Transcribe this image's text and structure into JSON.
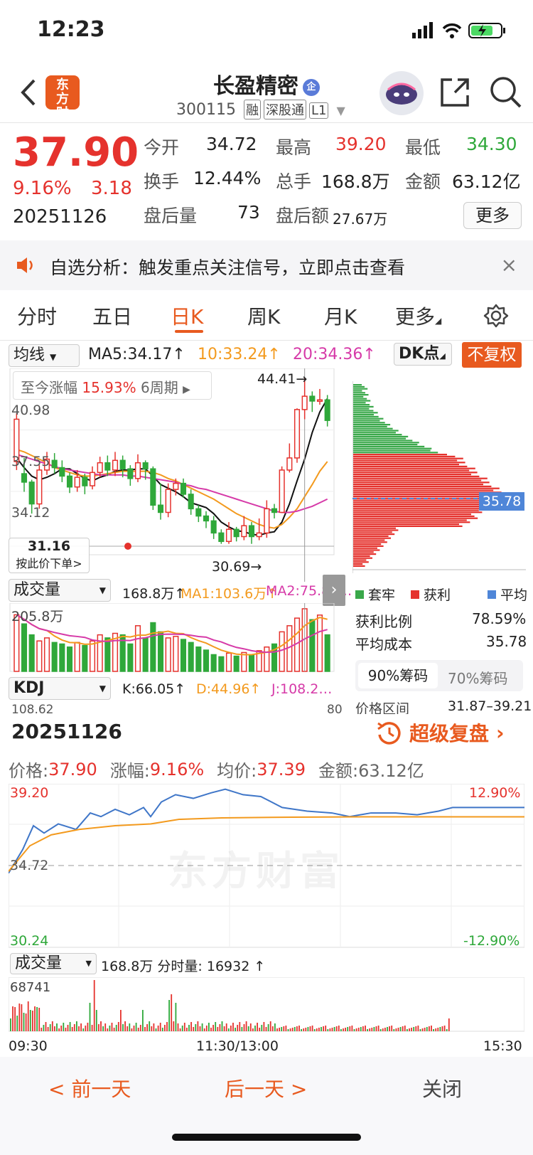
{
  "status": {
    "time": "12:23"
  },
  "header": {
    "logo_text": "东方财富",
    "name": "长盈精密",
    "name_badge": "企",
    "code": "300115",
    "tags": [
      "融",
      "深股通",
      "L1"
    ]
  },
  "quote": {
    "price": "37.90",
    "change_pct": "9.16%",
    "change_amt": "3.18",
    "date": "20251126",
    "open_label": "今开",
    "open": "34.72",
    "high_label": "最高",
    "high": "39.20",
    "low_label": "最低",
    "low": "34.30",
    "turnover_label": "换手",
    "turnover": "12.44%",
    "vol_label": "总手",
    "vol": "168.8万",
    "amount_label": "金额",
    "amount": "63.12亿",
    "after_vol_label": "盘后量",
    "after_vol": "73",
    "after_amt_label": "盘后额",
    "after_amt": "27.67万",
    "more": "更多"
  },
  "notice": {
    "text": "自选分析：触发重点关注信号，立即点击查看",
    "close": "×"
  },
  "tabs": [
    "分时",
    "五日",
    "日K",
    "周K",
    "月K",
    "更多"
  ],
  "kline": {
    "ma_select": "均线",
    "ma5": "MA5:34.17↑",
    "ma10": "10:33.24↑",
    "ma20": "20:34.36↑",
    "dk": "DK点",
    "fq": "不复权",
    "range_label": "至今涨幅",
    "range_pct": "15.93%",
    "range_period": "6周期",
    "ticks": [
      "44.41",
      "40.98",
      "37.55",
      "34.12",
      "31.16",
      "30.69"
    ],
    "peak_label": "44.41→",
    "trough_label": "30.69→",
    "order_price": "31.16",
    "order_hint": "按此价下单>",
    "vol_select": "成交量",
    "vol_total": "168.8万↑",
    "vol_ma1": "MA1:103.6万↑",
    "vol_ma2": "MA2:75.81…",
    "vol_tick": "205.8万",
    "kdj_select": "KDJ",
    "kdj_k": "K:66.05↑",
    "kdj_d": "D:44.96↑",
    "kdj_j": "J:108.2…",
    "kdj_tick_left": "108.62",
    "kdj_tick_right": "80",
    "candles": [
      [
        37.5,
        41.0,
        41.5,
        36.8
      ],
      [
        36.5,
        35.8,
        37.8,
        35.0
      ],
      [
        35.8,
        34.0,
        36.0,
        33.2
      ],
      [
        34.0,
        36.8,
        37.2,
        33.6
      ],
      [
        36.8,
        37.7,
        38.3,
        36.4
      ],
      [
        37.6,
        37.0,
        38.2,
        36.5
      ],
      [
        37.0,
        36.3,
        37.6,
        35.8
      ],
      [
        36.3,
        35.4,
        36.6,
        34.9
      ],
      [
        35.4,
        36.2,
        36.8,
        35.0
      ],
      [
        36.2,
        35.5,
        36.5,
        34.8
      ],
      [
        35.5,
        36.6,
        37.1,
        35.2
      ],
      [
        36.6,
        37.4,
        37.9,
        36.2
      ],
      [
        37.4,
        36.8,
        38.0,
        36.3
      ],
      [
        36.8,
        37.6,
        38.3,
        36.3
      ],
      [
        37.6,
        36.9,
        38.0,
        36.2
      ],
      [
        36.9,
        36.1,
        37.2,
        35.5
      ],
      [
        36.1,
        37.4,
        38.1,
        35.8
      ],
      [
        37.4,
        36.9,
        37.6,
        36.0
      ],
      [
        36.9,
        33.9,
        37.1,
        33.5
      ],
      [
        33.9,
        33.3,
        35.7,
        32.7
      ],
      [
        33.3,
        35.2,
        35.7,
        32.9
      ],
      [
        35.2,
        35.7,
        36.1,
        34.7
      ],
      [
        35.7,
        34.8,
        36.1,
        34.5
      ],
      [
        34.8,
        33.6,
        35.2,
        33.1
      ],
      [
        33.6,
        33.0,
        33.9,
        32.5
      ],
      [
        33.0,
        32.6,
        33.4,
        32.0
      ],
      [
        32.6,
        31.6,
        33.0,
        31.1
      ],
      [
        31.6,
        30.9,
        31.9,
        30.7
      ],
      [
        30.9,
        31.9,
        32.5,
        30.7
      ],
      [
        31.9,
        31.3,
        32.1,
        30.9
      ],
      [
        31.3,
        32.2,
        33.0,
        31.0
      ],
      [
        32.2,
        31.3,
        32.5,
        30.7
      ],
      [
        31.3,
        31.6,
        32.8,
        31.0
      ],
      [
        31.6,
        33.6,
        34.3,
        31.2
      ],
      [
        33.6,
        33.3,
        34.0,
        32.8
      ],
      [
        33.3,
        36.8,
        37.1,
        33.3
      ],
      [
        36.8,
        37.8,
        39.0,
        36.6
      ],
      [
        37.8,
        41.8,
        41.9,
        37.4
      ],
      [
        41.8,
        42.9,
        44.41,
        41.0
      ],
      [
        42.9,
        42.5,
        43.3,
        41.6
      ],
      [
        42.5,
        42.6,
        43.5,
        42.2
      ],
      [
        42.6,
        40.9,
        43.0,
        40.4
      ]
    ],
    "ma5_line": [
      37.8,
      37.0,
      36.3,
      36.0,
      36.2,
      36.5,
      36.9,
      36.9,
      36.5,
      36.1,
      35.9,
      36.2,
      36.4,
      36.7,
      36.8,
      36.8,
      36.9,
      36.9,
      36.3,
      35.6,
      35.3,
      35.0,
      34.6,
      34.1,
      33.9,
      33.7,
      33.2,
      32.5,
      32.1,
      31.8,
      31.7,
      31.5,
      31.4,
      31.6,
      31.7,
      32.5,
      34.0,
      35.9,
      37.7,
      39.9,
      41.6,
      42.7
    ],
    "ma10_line": [
      38.5,
      38.3,
      38.0,
      37.7,
      37.4,
      37.0,
      36.8,
      36.6,
      36.4,
      36.3,
      36.3,
      36.4,
      36.5,
      36.6,
      36.7,
      36.7,
      36.7,
      36.7,
      36.6,
      36.4,
      36.1,
      35.9,
      35.6,
      35.3,
      35.0,
      34.7,
      34.4,
      34.0,
      33.6,
      33.2,
      32.9,
      32.6,
      32.3,
      32.1,
      32.0,
      32.3,
      32.9,
      33.6,
      34.6,
      35.6,
      36.7,
      37.5
    ],
    "ma20_line": [
      38.1,
      37.9,
      37.7,
      37.5,
      37.3,
      37.1,
      36.9,
      36.8,
      36.7,
      36.6,
      36.5,
      36.4,
      36.4,
      36.4,
      36.4,
      36.3,
      36.3,
      36.2,
      36.1,
      36.0,
      35.9,
      35.8,
      35.6,
      35.5,
      35.3,
      35.2,
      35.0,
      34.8,
      34.6,
      34.4,
      34.2,
      34.0,
      33.8,
      33.6,
      33.4,
      33.3,
      33.3,
      33.4,
      33.6,
      33.8,
      34.1,
      34.4
    ],
    "volumes": [
      186,
      156,
      120,
      100,
      110,
      95,
      90,
      80,
      95,
      85,
      100,
      120,
      110,
      125,
      120,
      90,
      150,
      110,
      160,
      130,
      110,
      115,
      105,
      95,
      80,
      70,
      55,
      48,
      60,
      50,
      62,
      55,
      68,
      80,
      90,
      130,
      150,
      175,
      205.8,
      170,
      185,
      120
    ]
  },
  "chips": {
    "legend": [
      "套牢",
      "获利",
      "平均"
    ],
    "profit_ratio_label": "获利比例",
    "profit_ratio": "78.59%",
    "avg_cost_label": "平均成本",
    "avg_cost": "35.78",
    "avg_tag": "35.78",
    "tab90": "90%筹码",
    "tab70": "70%筹码",
    "range_label": "价格区间",
    "range": "31.87–39.21"
  },
  "intraday": {
    "date": "20251126",
    "replay": "超级复盘",
    "price_label": "价格:",
    "price": "37.90",
    "chg_label": "涨幅:",
    "chg": "9.16%",
    "avg_label": "均价:",
    "avg": "37.39",
    "amt_label": "金额:",
    "amt": "63.12亿",
    "top_price": "39.20",
    "mid_price": "34.72",
    "bottom_price": "30.24",
    "top_pct": "12.90%",
    "bottom_pct": "-12.90%",
    "vol_select": "成交量",
    "vol_info": "168.8万 分时量: 16932 ↑",
    "vol_tick": "68741",
    "time_start": "09:30",
    "time_mid": "11:30/13:00",
    "time_end": "15:30",
    "watermark": "东方财富"
  },
  "bottom": {
    "prev": "< 前一天",
    "next": "后一天 >",
    "close": "关闭"
  }
}
